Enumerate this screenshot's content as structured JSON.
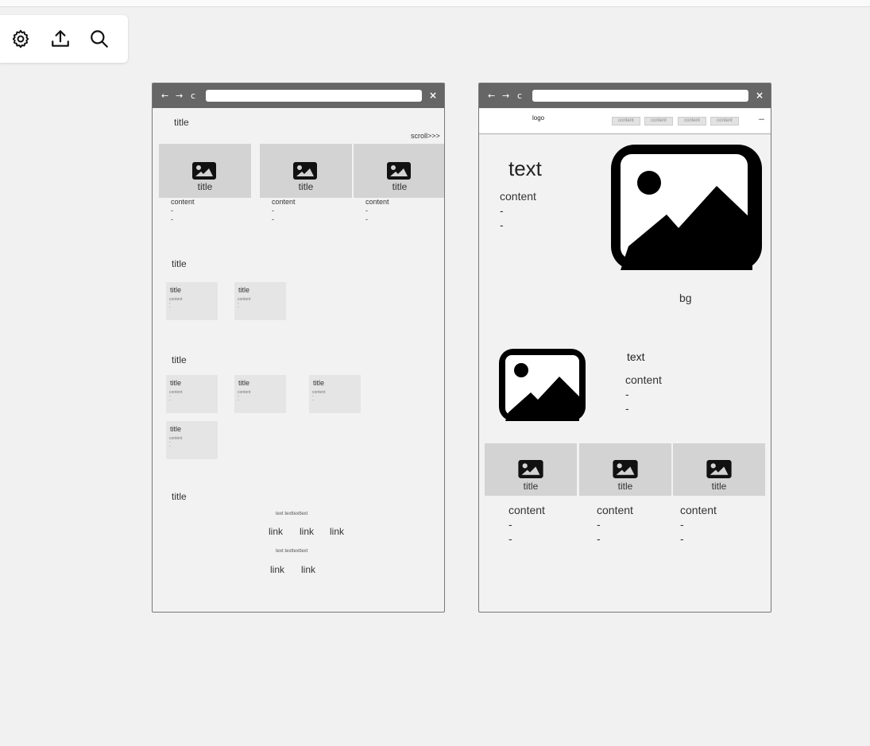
{
  "toolbar": {
    "icons": [
      "gear-icon",
      "upload-icon",
      "search-icon"
    ]
  },
  "left_window": {
    "close": "×",
    "nav": {
      "back": "←",
      "forward": "→",
      "reload": "c"
    },
    "section1_title": "title",
    "scroll_label": "scroll>>>",
    "carousel": [
      {
        "title": "title",
        "content": "content",
        "dash1": "-",
        "dash2": "-"
      },
      {
        "title": "title",
        "content": "content",
        "dash1": "-",
        "dash2": "-"
      },
      {
        "title": "title",
        "content": "content",
        "dash1": "-",
        "dash2": "-"
      }
    ],
    "section2_title": "title",
    "section2_cards": [
      {
        "title": "title",
        "content": "content",
        "d": "-"
      },
      {
        "title": "title",
        "content": "content",
        "d": "-"
      }
    ],
    "section3_title": "title",
    "section3_cards": [
      {
        "title": "title",
        "content": "content",
        "d": "-"
      },
      {
        "title": "title",
        "content": "content",
        "d": "-"
      },
      {
        "title": "title",
        "content": "content",
        "d": "-"
      },
      {
        "title": "title",
        "content": "content",
        "d": "-"
      }
    ],
    "section4_title": "title",
    "footer": {
      "text1": "text texttexttext",
      "links1": [
        "link",
        "link",
        "link"
      ],
      "text2": "text texttexttext",
      "links2": [
        "link",
        "link"
      ]
    }
  },
  "right_window": {
    "close": "×",
    "nav": {
      "back": "←",
      "forward": "→",
      "reload": "c"
    },
    "logo": "logo",
    "menu": [
      "content",
      "content",
      "content",
      "content"
    ],
    "menu_extra": "••••",
    "hero": {
      "text": "text",
      "content": "content",
      "dash1": "-",
      "dash2": "-",
      "bg": "bg"
    },
    "feature": {
      "text": "text",
      "content": "content",
      "dash1": "-",
      "dash2": "-"
    },
    "tiles": [
      {
        "title": "title",
        "content": "content",
        "dash1": "-",
        "dash2": "-"
      },
      {
        "title": "title",
        "content": "content",
        "dash1": "-",
        "dash2": "-"
      },
      {
        "title": "title",
        "content": "content",
        "dash1": "-",
        "dash2": "-"
      }
    ]
  }
}
